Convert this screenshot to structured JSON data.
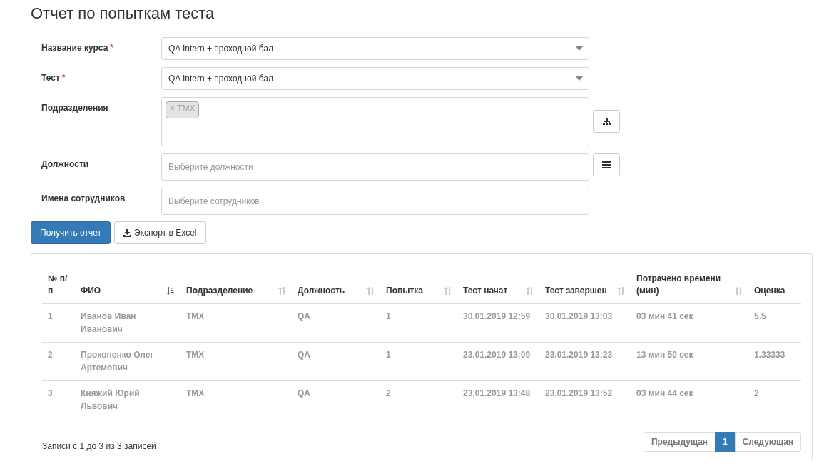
{
  "title": "Отчет по попыткам теста",
  "form": [
    {
      "kind": "select",
      "label": "Название курса",
      "required_mark": "*",
      "value": "QA Intern + проходной бал"
    },
    {
      "kind": "select",
      "label": "Тест",
      "required_mark": "*",
      "value": "QA Intern + проходной бал"
    },
    {
      "kind": "tags",
      "label": "Подразделения",
      "tags": [
        {
          "remove": "×",
          "label": "TMX"
        }
      ],
      "picker": {
        "kind": "tree"
      }
    },
    {
      "kind": "input",
      "label": "Должности",
      "placeholder": "Выберите должности",
      "picker": {
        "kind": "list"
      }
    },
    {
      "kind": "input",
      "label": "Имена сотрудников",
      "placeholder": "Выберите сотрудников"
    }
  ],
  "buttons": [
    {
      "label": "Получить отчет",
      "kind": "primary"
    },
    {
      "label": "Экспорт в Excel",
      "kind": "export"
    }
  ],
  "table": {
    "columns": [
      {
        "label": "№ п/п",
        "sortable": false,
        "sorted": false
      },
      {
        "label": "ФИО",
        "sortable": true,
        "sorted": true
      },
      {
        "label": "Подразделение",
        "sortable": true,
        "sorted": false
      },
      {
        "label": "Должность",
        "sortable": true,
        "sorted": false
      },
      {
        "label": "Попытка",
        "sortable": true,
        "sorted": false
      },
      {
        "label": "Тест начат",
        "sortable": true,
        "sorted": false
      },
      {
        "label": "Тест завершен",
        "sortable": true,
        "sorted": false
      },
      {
        "label": "Потрачено времени (мин)",
        "sortable": true,
        "sorted": false
      },
      {
        "label": "Оценка",
        "sortable": false,
        "sorted": false
      }
    ],
    "rows": [
      [
        "1",
        "Иванов Иван Иванович",
        "TMX",
        "QA",
        "1",
        "30.01.2019 12:59",
        "30.01.2019 13:03",
        "03 мин 41 сек",
        "5.5"
      ],
      [
        "2",
        "Прокопенко Олег Артемович",
        "TMX",
        "QA",
        "1",
        "23.01.2019 13:09",
        "23.01.2019 13:23",
        "13 мин 50 сек",
        "1.33333"
      ],
      [
        "3",
        "Княжий Юрий Львович",
        "TMX",
        "QA",
        "2",
        "23.01.2019 13:48",
        "23.01.2019 13:52",
        "03 мин 44 сек",
        "2"
      ]
    ],
    "info": "Записи с 1 до 3 из 3 записей",
    "pager": [
      {
        "label": "Предыдущая",
        "selected": false
      },
      {
        "label": "1",
        "selected": true
      },
      {
        "label": "Следующая",
        "selected": false
      }
    ]
  }
}
